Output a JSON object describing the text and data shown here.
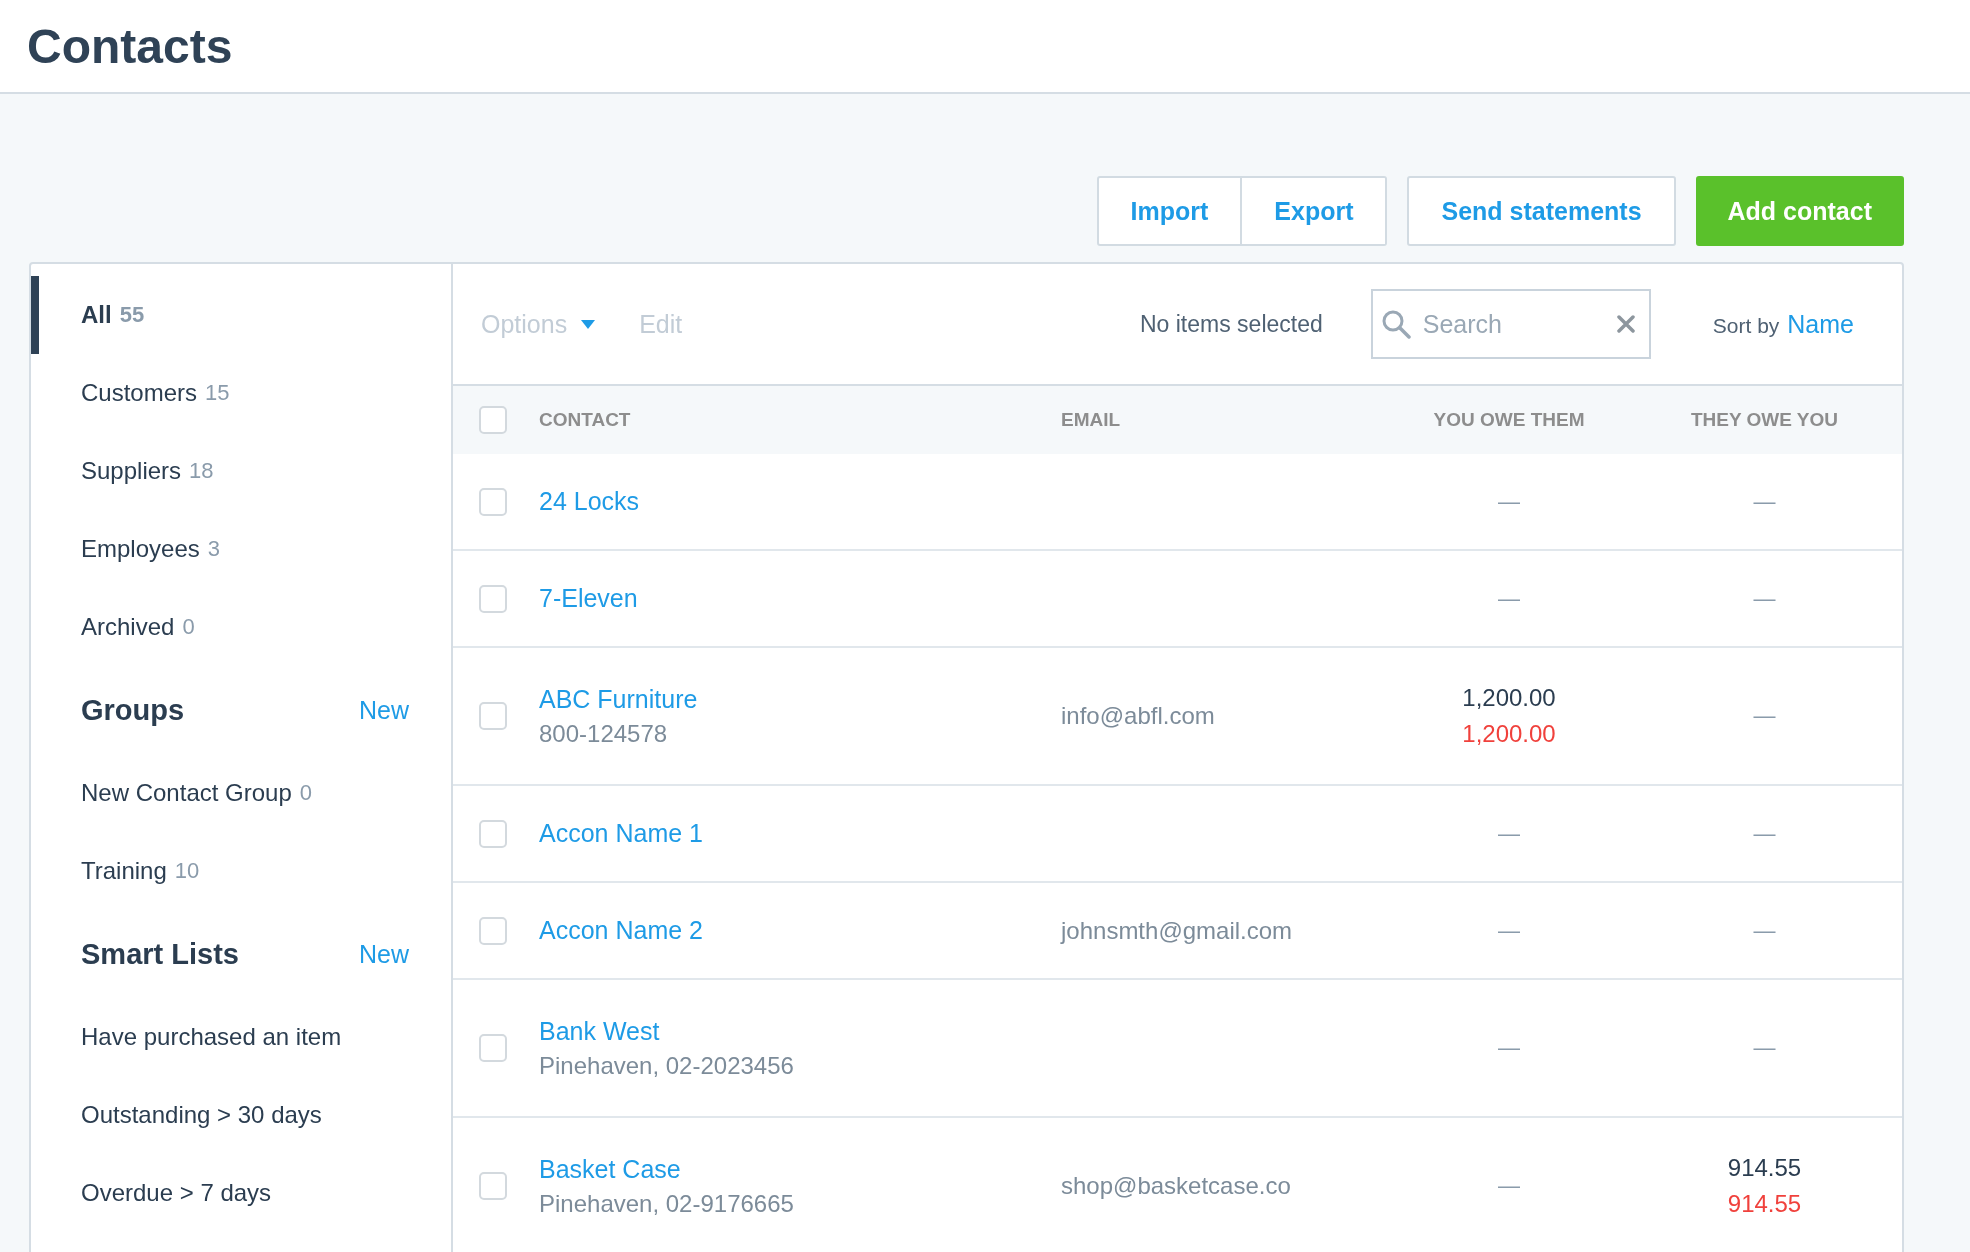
{
  "page": {
    "title": "Contacts"
  },
  "actions": [
    {
      "label": "Import",
      "kind": "outline"
    },
    {
      "label": "Export",
      "kind": "outline"
    },
    {
      "label": "Send statements",
      "kind": "outline"
    },
    {
      "label": "Add contact",
      "kind": "primary"
    }
  ],
  "sidebar": {
    "filters": [
      {
        "label": "All",
        "count": "55",
        "selected": true
      },
      {
        "label": "Customers",
        "count": "15",
        "selected": false
      },
      {
        "label": "Suppliers",
        "count": "18",
        "selected": false
      },
      {
        "label": "Employees",
        "count": "3",
        "selected": false
      },
      {
        "label": "Archived",
        "count": "0",
        "selected": false
      }
    ],
    "sections": [
      {
        "title": "Groups",
        "action": "New",
        "items": [
          {
            "label": "New Contact Group",
            "count": "0"
          },
          {
            "label": "Training",
            "count": "10"
          }
        ]
      },
      {
        "title": "Smart Lists",
        "action": "New",
        "items": [
          {
            "label": "Have purchased an item"
          },
          {
            "label": "Outstanding > 30 days"
          },
          {
            "label": "Overdue > 7 days"
          }
        ]
      }
    ]
  },
  "toolbar": {
    "options": {
      "label": "Options",
      "disabled": true
    },
    "edit": {
      "label": "Edit",
      "disabled": true
    },
    "selection": "No items selected",
    "search": {
      "placeholder": "Search"
    },
    "sort_label": "Sort by",
    "sort_value": "Name"
  },
  "table": {
    "all_checked": false,
    "columns": [
      "CONTACT",
      "EMAIL",
      "YOU OWE THEM",
      "THEY OWE YOU"
    ],
    "rows": [
      {
        "name": "24 Locks",
        "checked": false,
        "you_owe_them": [
          "—"
        ],
        "they_owe_you": [
          "—"
        ]
      },
      {
        "name": "7-Eleven",
        "checked": false,
        "you_owe_them": [
          "—"
        ],
        "they_owe_you": [
          "—"
        ]
      },
      {
        "name": "ABC Furniture",
        "detail": "800-124578",
        "checked": false,
        "email": "info@abfl.com",
        "you_owe_them": [
          "1,200.00",
          "1,200.00"
        ],
        "they_owe_you": [
          "—"
        ]
      },
      {
        "name": "Accon Name 1",
        "checked": false,
        "you_owe_them": [
          "—"
        ],
        "they_owe_you": [
          "—"
        ]
      },
      {
        "name": "Accon Name 2",
        "checked": false,
        "email": "johnsmth@gmail.com",
        "you_owe_them": [
          "—"
        ],
        "they_owe_you": [
          "—"
        ]
      },
      {
        "name": "Bank West",
        "detail": "Pinehaven, 02-2023456",
        "checked": false,
        "you_owe_them": [
          "—"
        ],
        "they_owe_you": [
          "—"
        ]
      },
      {
        "name": "Basket Case",
        "detail": "Pinehaven, 02-9176665",
        "checked": false,
        "email": "shop@basketcase.co",
        "you_owe_them": [
          "—"
        ],
        "they_owe_you": [
          "914.55",
          "914.55"
        ]
      }
    ]
  }
}
